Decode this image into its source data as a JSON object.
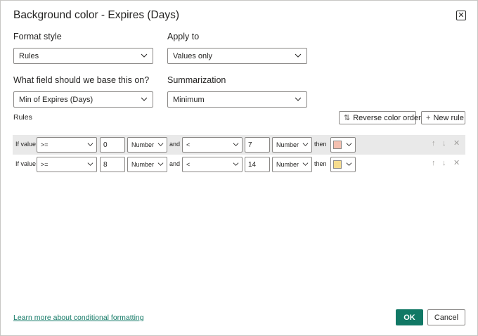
{
  "dialog": {
    "title": "Background color - Expires (Days)",
    "close_icon": "close-icon"
  },
  "format_style": {
    "label": "Format style",
    "value": "Rules"
  },
  "apply_to": {
    "label": "Apply to",
    "value": "Values only"
  },
  "base_field": {
    "label": "What field should we base this on?",
    "value": "Min of Expires (Days)"
  },
  "summarization": {
    "label": "Summarization",
    "value": "Minimum"
  },
  "rules": {
    "label": "Rules",
    "reverse_button": "Reverse color order",
    "new_rule_button": "New rule",
    "items": [
      {
        "if_label": "If value",
        "op1": ">=",
        "val1": "0",
        "type1": "Number",
        "and_label": "and",
        "op2": "<",
        "val2": "7",
        "type2": "Number",
        "then_label": "then",
        "color": "#f4c0b0"
      },
      {
        "if_label": "If value",
        "op1": ">=",
        "val1": "8",
        "type1": "Number",
        "and_label": "and",
        "op2": "<",
        "val2": "14",
        "type2": "Number",
        "then_label": "then",
        "color": "#f6dc8e"
      }
    ]
  },
  "footer": {
    "learn_more": "Learn more about conditional formatting",
    "ok": "OK",
    "cancel": "Cancel"
  },
  "colors": {
    "accent": "#117865",
    "border": "#8a8886",
    "row_highlight": "#e9e9e9"
  }
}
